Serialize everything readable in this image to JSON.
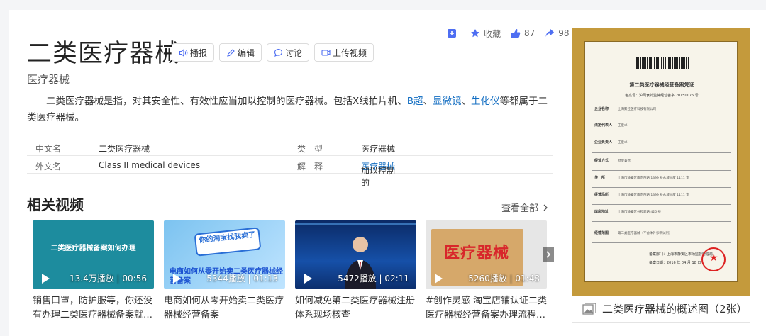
{
  "top_actions": {
    "collect_label": "收藏",
    "like_count": "87",
    "share_count": "98"
  },
  "title": "二类医疗器械",
  "title_buttons": {
    "play": "播报",
    "edit": "编辑",
    "discuss": "讨论",
    "upload": "上传视频"
  },
  "subtitle": "医疗器械",
  "summary": {
    "part1": "二类医疗器械是指，对其安全性、有效性应当加以控制的医疗器械。包括X线拍片机、",
    "link1": "B超",
    "sep1": "、",
    "link2": "显微镜",
    "sep2": "、",
    "link3": "生化仪",
    "part2": "等都属于二类医疗器械。"
  },
  "info": {
    "row1": {
      "k1": "中文名",
      "v1": "二类医疗器械",
      "k2": "类　型",
      "v2": "医疗器械"
    },
    "row2": {
      "k1": "外文名",
      "v1": "Class II medical devices",
      "k2": "解　释",
      "v2_prefix": "加以控制的",
      "v2_link": "医疗器械"
    }
  },
  "related_videos": {
    "title": "相关视频",
    "see_all": "查看全部",
    "items": [
      {
        "thumb_text": "二类医疗器械备案如何办理",
        "meta": "13.4万播放 | 00:56",
        "caption": "销售口罩，防护服等，你还没有办理二类医疗器械备案就…"
      },
      {
        "thumb_text": "电商如何从零开始卖二类医疗器械经营备案",
        "bubble_text": "你的淘宝找我卖了",
        "meta": "5344播放 | 01:13",
        "caption": "电商如何从零开始卖二类医疗器械经营备案"
      },
      {
        "meta": "5472播放 | 02:11",
        "caption": "如何减免第二类医疗器械注册体系现场核查"
      },
      {
        "thumb_text": "医疗器械",
        "meta": "5260播放 | 01:48",
        "caption": "#创作灵感 淘宝店铺认证二类医疗器械经营备案办理流程…"
      }
    ]
  },
  "certificate": {
    "title": "第二类医疗器械经营备案凭证",
    "number": "备案号：沪网食药监械经营备字 20150076 号",
    "rows": [
      {
        "label": "企业名称",
        "value": "上海聚佳医疗科技有限公司"
      },
      {
        "label": "法定代表人",
        "value": "王俊卓"
      },
      {
        "label": "企业负责人",
        "value": "王俊卓"
      },
      {
        "label": "经营方式",
        "value": "批零兼营"
      },
      {
        "label": "住　所",
        "value": "上海市静安区南京西路 1399 号永城大厦 1111 室"
      },
      {
        "label": "经营场所",
        "value": "上海市静安区南京西路 1399 号永城大厦 1111 室"
      },
      {
        "label": "库房地址",
        "value": "上海市静安区共和新路 426 号"
      },
      {
        "label": "经营范围",
        "value": "第二类医疗器械（不含体外诊断试剂）"
      }
    ],
    "footer1": "备案部门：上海市静安区市场监督管理局",
    "footer2": "备案日期：2016 年 04 月 18 日"
  },
  "image_caption": "二类医疗器械的概述图（2张）",
  "colors": {
    "link": "#136ec2",
    "accent": "#4e6ef2"
  }
}
